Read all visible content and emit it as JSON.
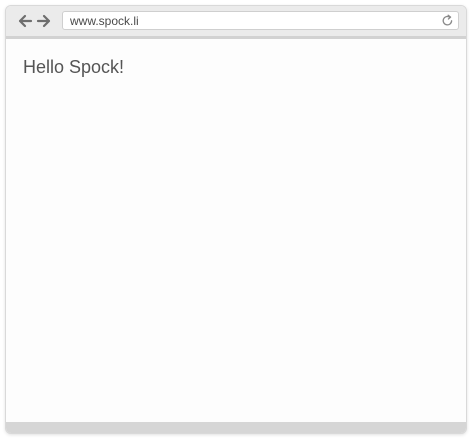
{
  "browser": {
    "url": "www.spock.li",
    "icons": {
      "back": "arrow-left-icon",
      "forward": "arrow-right-icon",
      "reload": "reload-icon"
    }
  },
  "page": {
    "heading": "Hello Spock!"
  },
  "colors": {
    "chrome": "#ebebeb",
    "chrome_border": "#d2d2d2",
    "heading_text": "#555555",
    "icon": "#6e6e6e"
  }
}
